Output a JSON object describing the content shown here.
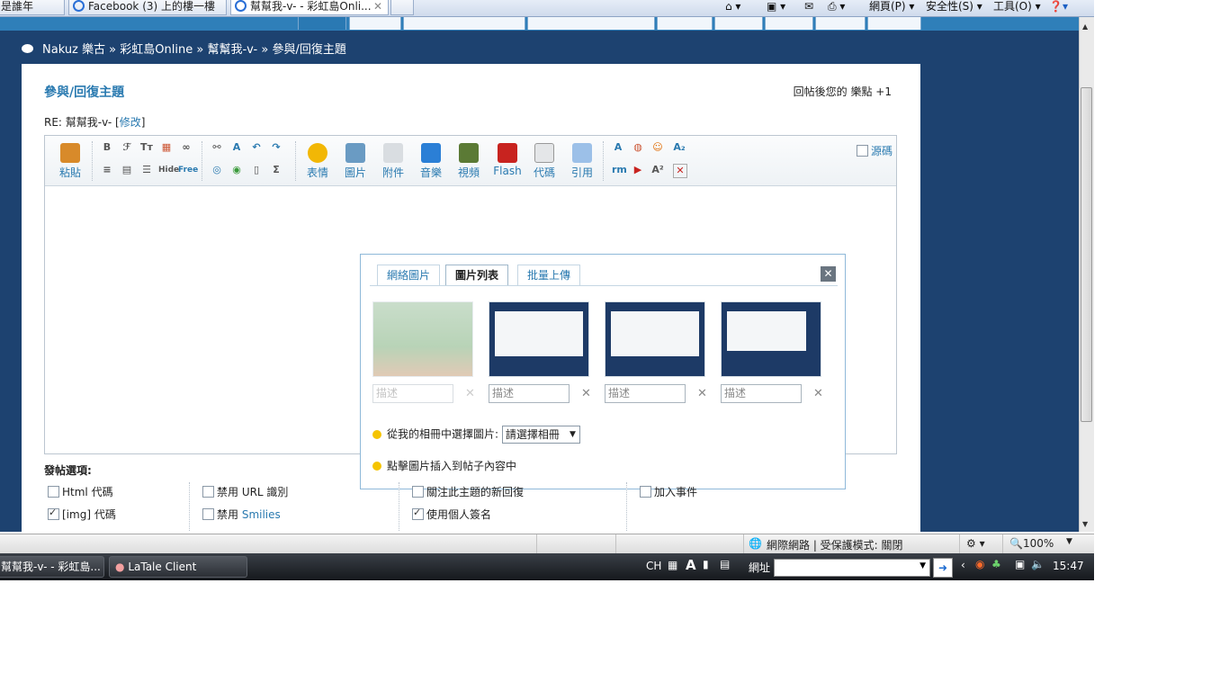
{
  "browser": {
    "tabs": [
      {
        "label": "是誰年"
      },
      {
        "label": "Facebook (3) 上的樓一樓"
      },
      {
        "label": "幫幫我-v- - 彩虹島Onli..."
      }
    ],
    "commands": {
      "page": "網頁(P) ▾",
      "safety": "安全性(S) ▾",
      "tools": "工具(O) ▾"
    }
  },
  "breadcrumb": {
    "site": "Nakuz 樂古",
    "sep1": "»",
    "forum": "彩虹島Online",
    "sep2": "»",
    "thread": "幫幫我-v-",
    "sep3": "»",
    "current": "參與/回復主題"
  },
  "post": {
    "title": "參與/回復主題",
    "reward": "回帖後您的 樂點 +1",
    "subject_prefix": "RE: 幫幫我-v- [",
    "subject_edit": "修改",
    "subject_suffix": "]"
  },
  "toolbar": {
    "paste": "粘貼",
    "emotion": "表情",
    "image": "圖片",
    "attach": "附件",
    "music": "音樂",
    "video": "視頻",
    "flash": "Flash",
    "code": "代碼",
    "quote": "引用",
    "source": "源碼",
    "small_icons": {
      "bold": "B",
      "format": "ℱ",
      "fontsize": "Tт",
      "hide": "Hide",
      "free": "Free"
    }
  },
  "image_dialog": {
    "tabs": [
      {
        "label": "網絡圖片"
      },
      {
        "label": "圖片列表"
      },
      {
        "label": "批量上傳"
      }
    ],
    "close": "✕",
    "desc_placeholder": "描述",
    "remove": "✕",
    "album_label": "從我的相冊中選擇圖片:",
    "album_select": "請選擇相冊",
    "insert_hint": "點擊圖片插入到帖子內容中"
  },
  "options": {
    "heading": "發帖選項:",
    "html": "Html 代碼",
    "img": "[img] 代碼",
    "no_url": "禁用 URL 識別",
    "no_smilies_prefix": "禁用 ",
    "no_smilies_link": "Smilies",
    "subscribe": "關注此主題的新回復",
    "signature": "使用個人簽名",
    "event": "加入事件",
    "checked": {
      "html": false,
      "img": true,
      "no_url": false,
      "no_smilies": false,
      "subscribe": false,
      "signature": true,
      "event": false
    }
  },
  "statusbar": {
    "zone": "網際網路 | 受保護模式: 關閉",
    "zoom": "100%"
  },
  "taskbar": {
    "tasks": [
      {
        "label": "幫幫我-v- - 彩虹島..."
      },
      {
        "label": "LaTale Client"
      }
    ],
    "lang": "CH",
    "address_label": "網址",
    "time": "15:47"
  },
  "colors": {
    "page_bg": "#1d4270",
    "nav_strip": "#2f7fb9",
    "link": "#2a7ab0"
  }
}
